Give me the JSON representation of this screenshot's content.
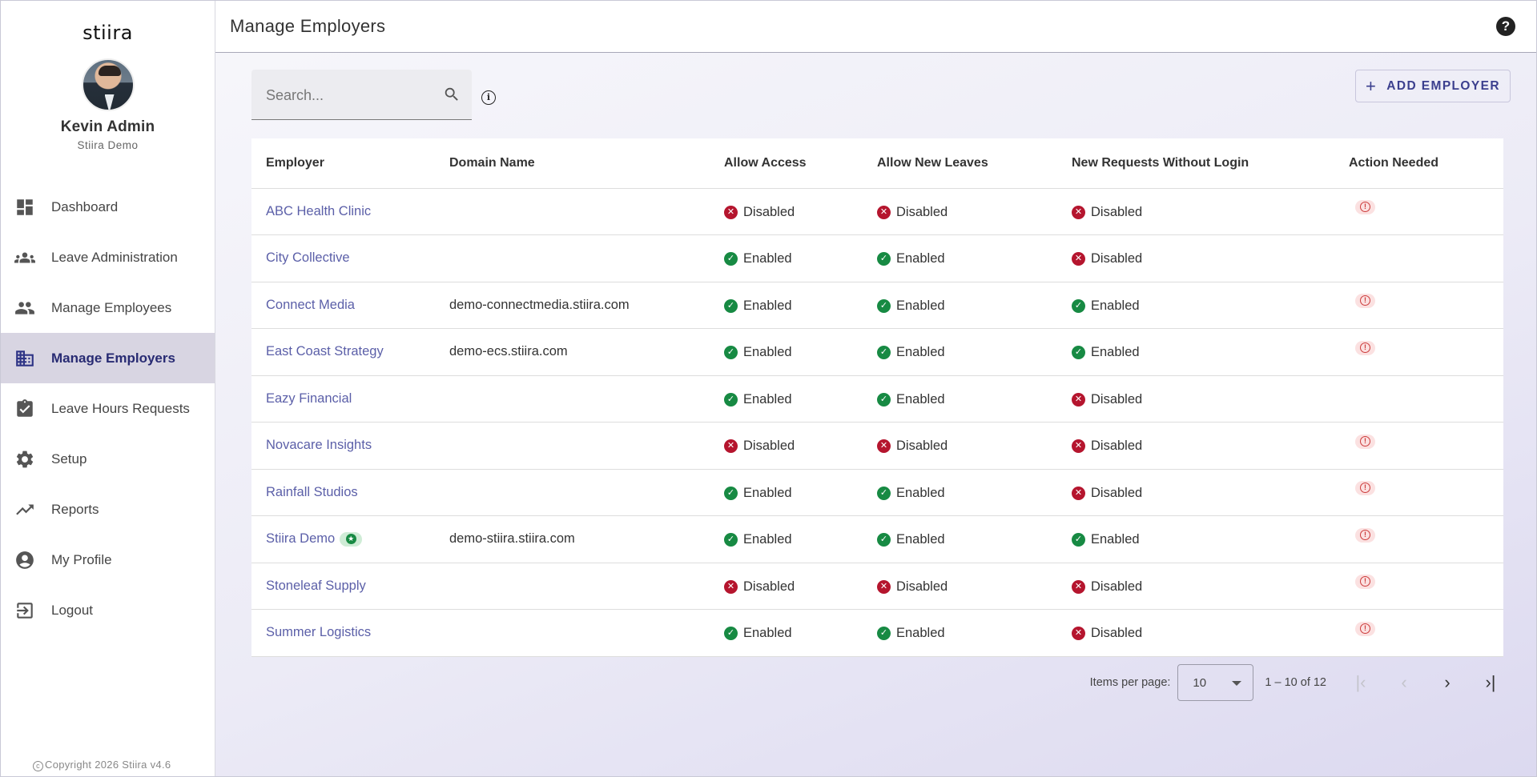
{
  "app": {
    "logo_text": "stiira",
    "copyright": "Copyright 2026 Stiira v4.6"
  },
  "user": {
    "name": "Kevin Admin",
    "org": "Stiira Demo"
  },
  "sidebar": {
    "items": [
      {
        "label": "Dashboard",
        "icon": "dashboard-icon"
      },
      {
        "label": "Leave Administration",
        "icon": "groups-icon"
      },
      {
        "label": "Manage Employees",
        "icon": "people-icon"
      },
      {
        "label": "Manage Employers",
        "icon": "building-icon",
        "active": true
      },
      {
        "label": "Leave Hours Requests",
        "icon": "clipboard-check-icon"
      },
      {
        "label": "Setup",
        "icon": "gear-icon"
      },
      {
        "label": "Reports",
        "icon": "trending-up-icon"
      },
      {
        "label": "My Profile",
        "icon": "account-circle-icon"
      },
      {
        "label": "Logout",
        "icon": "logout-icon"
      }
    ]
  },
  "header": {
    "title": "Manage Employers",
    "help_icon": "help-icon"
  },
  "search": {
    "placeholder": "Search...",
    "value": ""
  },
  "toolbar": {
    "add_label": "ADD EMPLOYER"
  },
  "table": {
    "columns": [
      "Employer",
      "Domain Name",
      "Allow Access",
      "Allow New Leaves",
      "New Requests Without Login",
      "Action Needed"
    ],
    "rows": [
      {
        "employer": "ABC Health Clinic",
        "domain": "",
        "access": "Disabled",
        "leaves": "Disabled",
        "requests": "Disabled",
        "action": true
      },
      {
        "employer": "City Collective",
        "domain": "",
        "access": "Enabled",
        "leaves": "Enabled",
        "requests": "Disabled",
        "action": false
      },
      {
        "employer": "Connect Media",
        "domain": "demo-connectmedia.stiira.com",
        "access": "Enabled",
        "leaves": "Enabled",
        "requests": "Enabled",
        "action": true
      },
      {
        "employer": "East Coast Strategy",
        "domain": "demo-ecs.stiira.com",
        "access": "Enabled",
        "leaves": "Enabled",
        "requests": "Enabled",
        "action": true
      },
      {
        "employer": "Eazy Financial",
        "domain": "",
        "access": "Enabled",
        "leaves": "Enabled",
        "requests": "Disabled",
        "action": false
      },
      {
        "employer": "Novacare Insights",
        "domain": "",
        "access": "Disabled",
        "leaves": "Disabled",
        "requests": "Disabled",
        "action": true
      },
      {
        "employer": "Rainfall Studios",
        "domain": "",
        "access": "Enabled",
        "leaves": "Enabled",
        "requests": "Disabled",
        "action": true
      },
      {
        "employer": "Stiira Demo",
        "domain": "demo-stiira.stiira.com",
        "access": "Enabled",
        "leaves": "Enabled",
        "requests": "Enabled",
        "action": true,
        "badge": "star-badge-icon"
      },
      {
        "employer": "Stoneleaf Supply",
        "domain": "",
        "access": "Disabled",
        "leaves": "Disabled",
        "requests": "Disabled",
        "action": true
      },
      {
        "employer": "Summer Logistics",
        "domain": "",
        "access": "Enabled",
        "leaves": "Enabled",
        "requests": "Disabled",
        "action": true
      }
    ]
  },
  "pagination": {
    "items_per_page_label": "Items per page:",
    "items_per_page": "10",
    "range": "1 – 10 of 12"
  },
  "colors": {
    "accent": "#2e3486",
    "link": "#5b5fa8",
    "enabled": "#178a43",
    "disabled": "#b5152e",
    "warning": "#cc3c3c"
  }
}
